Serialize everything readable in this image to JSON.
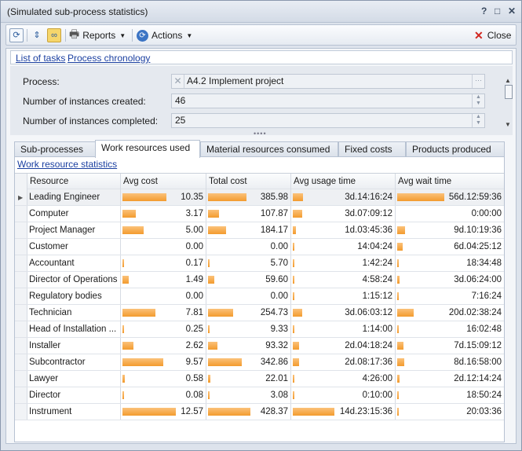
{
  "window": {
    "title": "(Simulated sub-process statistics)",
    "help": "?",
    "restore": "□",
    "close": "✕"
  },
  "toolbar": {
    "reports_label": "Reports",
    "actions_label": "Actions",
    "close_label": "Close"
  },
  "links": {
    "list_of_tasks": "List of tasks",
    "process_chronology": "Process chronology"
  },
  "form": {
    "process_label": "Process:",
    "process_value": "A4.2 Implement project",
    "created_label": "Number of instances created:",
    "created_value": "46",
    "completed_label": "Number of instances completed:",
    "completed_value": "25"
  },
  "tabs": [
    "Sub-processes",
    "Work resources used",
    "Material resources consumed",
    "Fixed costs",
    "Products produced"
  ],
  "active_tab": 1,
  "panel": {
    "link": "Work resource statistics"
  },
  "columns": [
    "Resource",
    "Avg cost",
    "Total cost",
    "Avg usage time",
    "Avg wait time"
  ],
  "rows": [
    {
      "resource": "Leading Engineer",
      "avg_cost": "10.35",
      "total_cost": "385.98",
      "avg_usage": "3d.14:16:24",
      "avg_wait": "56d.12:59:36",
      "selected": true
    },
    {
      "resource": "Computer",
      "avg_cost": "3.17",
      "total_cost": "107.87",
      "avg_usage": "3d.07:09:12",
      "avg_wait": "0:00:00"
    },
    {
      "resource": "Project Manager",
      "avg_cost": "5.00",
      "total_cost": "184.17",
      "avg_usage": "1d.03:45:36",
      "avg_wait": "9d.10:19:36"
    },
    {
      "resource": "Customer",
      "avg_cost": "0.00",
      "total_cost": "0.00",
      "avg_usage": "14:04:24",
      "avg_wait": "6d.04:25:12"
    },
    {
      "resource": "Accountant",
      "avg_cost": "0.17",
      "total_cost": "5.70",
      "avg_usage": "1:42:24",
      "avg_wait": "18:34:48"
    },
    {
      "resource": "Director of Operations",
      "avg_cost": "1.49",
      "total_cost": "59.60",
      "avg_usage": "4:58:24",
      "avg_wait": "3d.06:24:00"
    },
    {
      "resource": "Regulatory bodies",
      "avg_cost": "0.00",
      "total_cost": "0.00",
      "avg_usage": "1:15:12",
      "avg_wait": "7:16:24"
    },
    {
      "resource": "Technician",
      "avg_cost": "7.81",
      "total_cost": "254.73",
      "avg_usage": "3d.06:03:12",
      "avg_wait": "20d.02:38:24"
    },
    {
      "resource": "Head of Installation ...",
      "avg_cost": "0.25",
      "total_cost": "9.33",
      "avg_usage": "1:14:00",
      "avg_wait": "16:02:48"
    },
    {
      "resource": "Installer",
      "avg_cost": "2.62",
      "total_cost": "93.32",
      "avg_usage": "2d.04:18:24",
      "avg_wait": "7d.15:09:12"
    },
    {
      "resource": "Subcontractor",
      "avg_cost": "9.57",
      "total_cost": "342.86",
      "avg_usage": "2d.08:17:36",
      "avg_wait": "8d.16:58:00"
    },
    {
      "resource": "Lawyer",
      "avg_cost": "0.58",
      "total_cost": "22.01",
      "avg_usage": "4:26:00",
      "avg_wait": "2d.12:14:24"
    },
    {
      "resource": "Director",
      "avg_cost": "0.08",
      "total_cost": "3.08",
      "avg_usage": "0:10:00",
      "avg_wait": "18:50:24"
    },
    {
      "resource": "Instrument",
      "avg_cost": "12.57",
      "total_cost": "428.37",
      "avg_usage": "14d.23:15:36",
      "avg_wait": "20:03:36"
    }
  ],
  "accent_color": "#f39b2e"
}
